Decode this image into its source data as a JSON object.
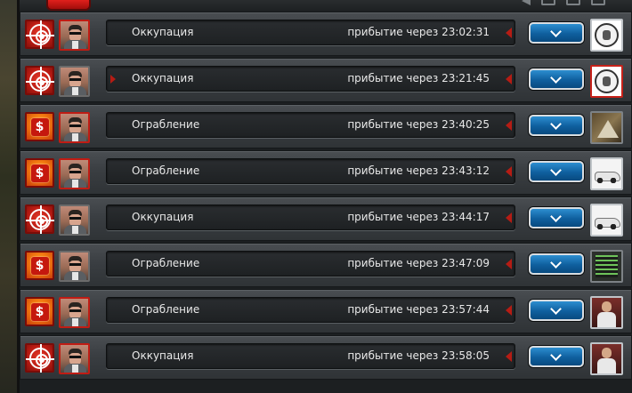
{
  "colors": {
    "attack_badge": "#b81a12",
    "robbery_badge": "#f27a10",
    "expand_button": "#0f5f9e",
    "row_text": "#e8e8e8",
    "accent_red": "#b51c14"
  },
  "icons": {
    "attack": "target-icon",
    "robbery": "dollar-icon",
    "expand": "chevron-down-icon"
  },
  "missions": [
    {
      "type": "attack",
      "name": "Оккупация",
      "arrival": "прибытие через 23:02:31",
      "thumb": "emblem",
      "avatar_active": true,
      "left_arrow": false
    },
    {
      "type": "attack",
      "name": "Оккупация",
      "arrival": "прибытие через 23:21:45",
      "thumb": "emblem",
      "avatar_active": false,
      "left_arrow": true
    },
    {
      "type": "robbery",
      "name": "Ограбление",
      "arrival": "прибытие через 23:40:25",
      "thumb": "pyramid",
      "avatar_active": true,
      "left_arrow": false
    },
    {
      "type": "robbery",
      "name": "Ограбление",
      "arrival": "прибытие через 23:43:12",
      "thumb": "car",
      "avatar_active": true,
      "left_arrow": false
    },
    {
      "type": "attack",
      "name": "Оккупация",
      "arrival": "прибытие через 23:44:17",
      "thumb": "car",
      "avatar_active": false,
      "left_arrow": false
    },
    {
      "type": "robbery",
      "name": "Ограбление",
      "arrival": "прибытие через 23:47:09",
      "thumb": "screen",
      "avatar_active": false,
      "left_arrow": false
    },
    {
      "type": "robbery",
      "name": "Ограбление",
      "arrival": "прибытие через 23:57:44",
      "thumb": "portrait",
      "avatar_active": true,
      "left_arrow": false
    },
    {
      "type": "attack",
      "name": "Оккупация",
      "arrival": "прибытие через 23:58:05",
      "thumb": "portrait",
      "avatar_active": true,
      "left_arrow": false
    }
  ]
}
